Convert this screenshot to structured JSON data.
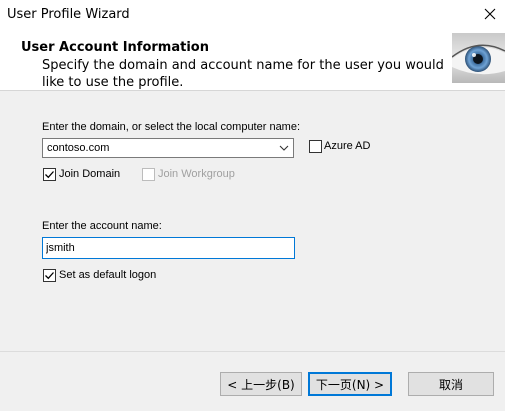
{
  "window": {
    "title": "User Profile Wizard",
    "close_icon": "close-icon"
  },
  "header": {
    "title": "User Account Information",
    "subtitle": "Specify the domain and account name for the user you would like to use the profile.",
    "image_icon": "blue-eye-image"
  },
  "domain": {
    "label": "Enter the domain, or select the local computer name:",
    "value": "contoso.com",
    "azure_ad_label": "Azure AD",
    "azure_ad_checked": false,
    "join_domain_label": "Join Domain",
    "join_domain_checked": true,
    "join_workgroup_label": "Join Workgroup",
    "join_workgroup_checked": false,
    "join_workgroup_enabled": false
  },
  "account": {
    "label": "Enter the account name:",
    "value": "jsmith",
    "default_logon_label": "Set as default logon",
    "default_logon_checked": true
  },
  "buttons": {
    "back_label": "< 上一步(B)",
    "next_label": "下一页(N) >",
    "cancel_label": "取消"
  },
  "colors": {
    "accent": "#0078d7",
    "dialog_bg": "#f0f0f0"
  }
}
